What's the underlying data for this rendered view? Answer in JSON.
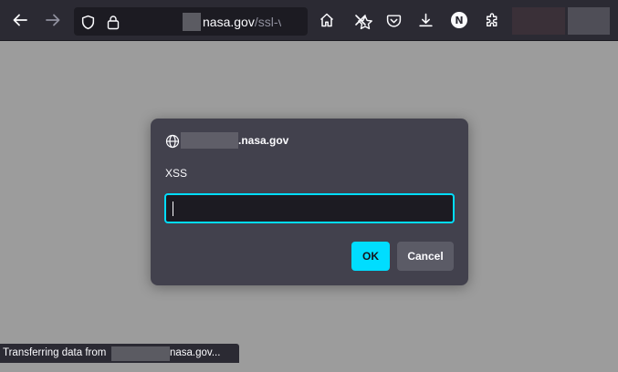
{
  "toolbar": {
    "back_icon": "arrow-left-icon",
    "forward_icon": "arrow-right-icon",
    "url": {
      "host": "nasa.gov",
      "path": "/ssl-vp"
    },
    "icons": [
      "shield-icon",
      "lock-icon",
      "star-icon",
      "home-icon",
      "close-icon",
      "pocket-icon",
      "download-icon",
      "account-icon",
      "extensions-icon"
    ],
    "account_initial": "N"
  },
  "dialog": {
    "host": ".nasa.gov",
    "message": "XSS",
    "input_value": "",
    "ok_label": "OK",
    "cancel_label": "Cancel"
  },
  "status": {
    "prefix": "Transferring data from",
    "suffix": "nasa.gov..."
  },
  "colors": {
    "toolbar_bg": "#2b2a33",
    "dialog_bg": "#42414d",
    "accent": "#00ddff",
    "page_overlay": "#9c9c9c"
  }
}
